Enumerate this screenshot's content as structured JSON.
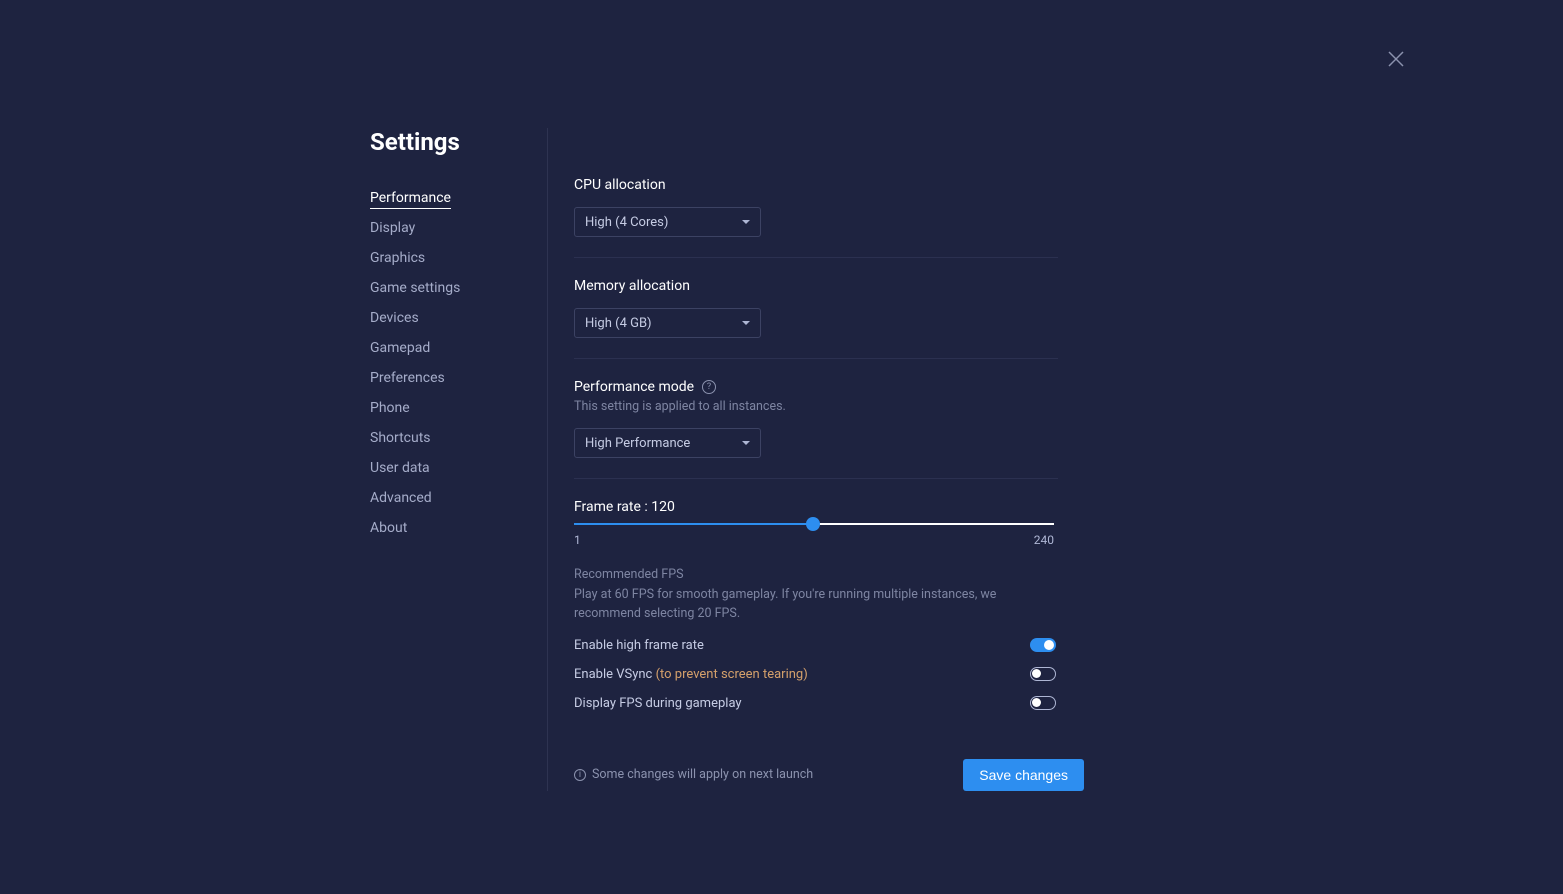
{
  "header": {
    "title": "Settings"
  },
  "sidebar": {
    "items": [
      {
        "label": "Performance",
        "active": true
      },
      {
        "label": "Display",
        "active": false
      },
      {
        "label": "Graphics",
        "active": false
      },
      {
        "label": "Game settings",
        "active": false
      },
      {
        "label": "Devices",
        "active": false
      },
      {
        "label": "Gamepad",
        "active": false
      },
      {
        "label": "Preferences",
        "active": false
      },
      {
        "label": "Phone",
        "active": false
      },
      {
        "label": "Shortcuts",
        "active": false
      },
      {
        "label": "User data",
        "active": false
      },
      {
        "label": "Advanced",
        "active": false
      },
      {
        "label": "About",
        "active": false
      }
    ]
  },
  "cpu": {
    "label": "CPU allocation",
    "value": "High (4 Cores)"
  },
  "memory": {
    "label": "Memory allocation",
    "value": "High (4 GB)"
  },
  "perf_mode": {
    "label": "Performance mode",
    "hint": "This setting is applied to all instances.",
    "value": "High Performance"
  },
  "frame_rate": {
    "label": "Frame rate : 120",
    "min": "1",
    "max": "240",
    "value": 120,
    "rec_title": "Recommended FPS",
    "rec_text": "Play at 60 FPS for smooth gameplay. If you're running multiple instances, we recommend selecting 20 FPS."
  },
  "toggles": {
    "high_frame": {
      "label": "Enable high frame rate",
      "on": true
    },
    "vsync": {
      "label_prefix": "Enable VSync ",
      "label_paren": "(to prevent screen tearing)",
      "on": false
    },
    "display_fps": {
      "label": "Display FPS during gameplay",
      "on": false
    }
  },
  "footer": {
    "note": "Some changes will apply on next launch",
    "save": "Save changes"
  }
}
